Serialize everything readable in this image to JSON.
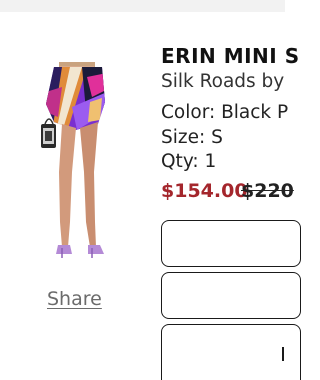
{
  "product": {
    "title": "ERIN MINI S",
    "brand": "Silk Roads by",
    "color": "Color: Black P",
    "size": "Size: S",
    "qty": "Qty: 1",
    "sale_price": "$154.00",
    "original_price": "$220"
  },
  "share": {
    "label": "Share"
  },
  "colors": {
    "sale": "#a4262c",
    "text": "#1a1a1a",
    "link": "#6b6b6b"
  }
}
